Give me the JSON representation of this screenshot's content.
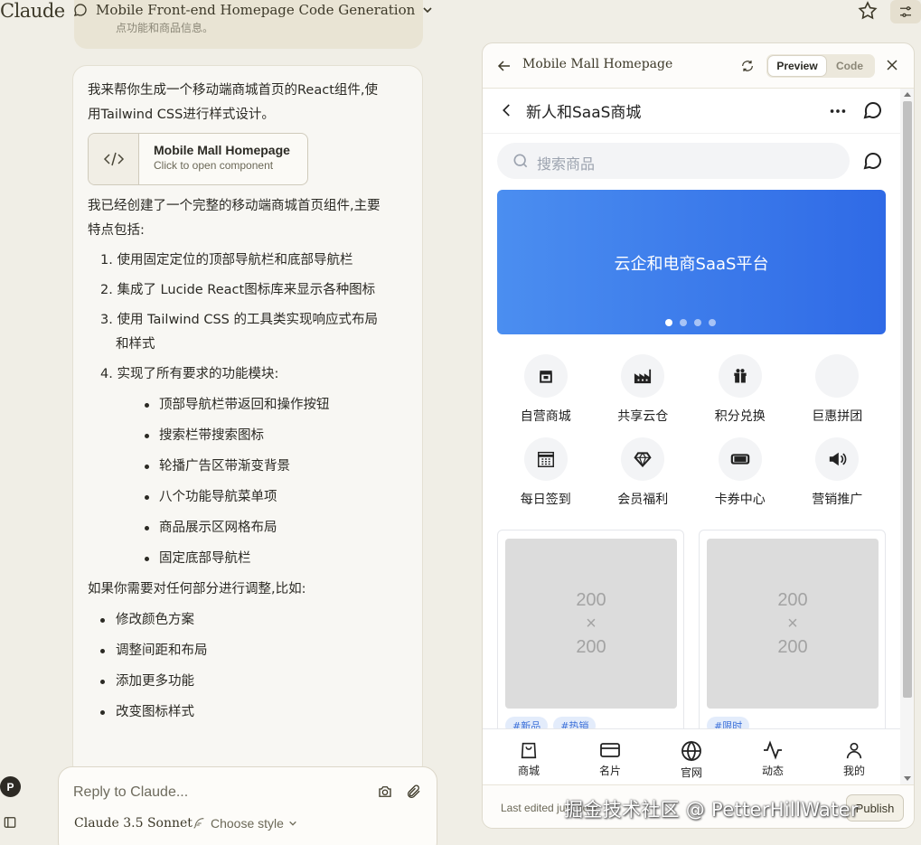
{
  "app": {
    "brand": "Claude",
    "chat_title": "Mobile Front-end Homepage Code Generation",
    "prev_message_tail": "点功能和商品信息。"
  },
  "message": {
    "intro": "我来帮你生成一个移动端商城首页的React组件,使用Tailwind CSS进行样式设计。",
    "artifact_title": "Mobile Mall Homepage",
    "artifact_subtitle": "Click to open component",
    "summary": "我已经创建了一个完整的移动端商城首页组件,主要特点包括:",
    "points": [
      "1. 使用固定定位的顶部导航栏和底部导航栏",
      "2. 集成了 Lucide React图标库来显示各种图标",
      "3. 使用 Tailwind CSS 的工具类实现响应式布局和样式",
      "4. 实现了所有要求的功能模块:"
    ],
    "modules": [
      "顶部导航栏带返回和操作按钮",
      "搜索栏带搜索图标",
      "轮播广告区带渐变背景",
      "八个功能导航菜单项",
      "商品展示区网格布局",
      "固定底部导航栏"
    ],
    "adjust_intro": "如果你需要对任何部分进行调整,比如:",
    "adjustments": [
      "修改颜色方案",
      "调整间距和布局",
      "添加更多功能",
      "改变图标样式"
    ]
  },
  "reply": {
    "placeholder": "Reply to Claude...",
    "model": "Claude 3.5 Sonnet",
    "style": "Choose style"
  },
  "user": {
    "initial": "P"
  },
  "panel": {
    "title": "Mobile Mall Homepage",
    "preview_label": "Preview",
    "code_label": "Code",
    "footer_text": "Last edited just now",
    "publish_label": "Publish"
  },
  "mall": {
    "shop_name": "新人和SaaS商城",
    "search_placeholder": "搜索商品",
    "banner_text": "云企和电商SaaS平台",
    "banner_dots": 4,
    "menu": [
      {
        "label": "自营商城",
        "icon": "store-icon"
      },
      {
        "label": "共享云仓",
        "icon": "factory-icon"
      },
      {
        "label": "积分兑换",
        "icon": "gift-icon"
      },
      {
        "label": "巨惠拼团",
        "icon": "users-icon"
      },
      {
        "label": "每日签到",
        "icon": "calendar-icon"
      },
      {
        "label": "会员福利",
        "icon": "gem-icon"
      },
      {
        "label": "卡券中心",
        "icon": "ticket-icon"
      },
      {
        "label": "营销推广",
        "icon": "megaphone-icon"
      }
    ],
    "products": [
      {
        "img_w": "200",
        "img_x": "×",
        "img_h": "200",
        "tags": [
          "#新品",
          "#热销"
        ]
      },
      {
        "img_w": "200",
        "img_x": "×",
        "img_h": "200",
        "tags": [
          "#限时"
        ]
      }
    ],
    "tabs": [
      {
        "label": "商城",
        "icon": "shopping-bag-icon"
      },
      {
        "label": "名片",
        "icon": "credit-card-icon"
      },
      {
        "label": "官网",
        "icon": "globe-icon"
      },
      {
        "label": "动态",
        "icon": "activity-icon"
      },
      {
        "label": "我的",
        "icon": "user-icon"
      }
    ]
  },
  "watermark": "掘金技术社区 @ PetterHillWater"
}
